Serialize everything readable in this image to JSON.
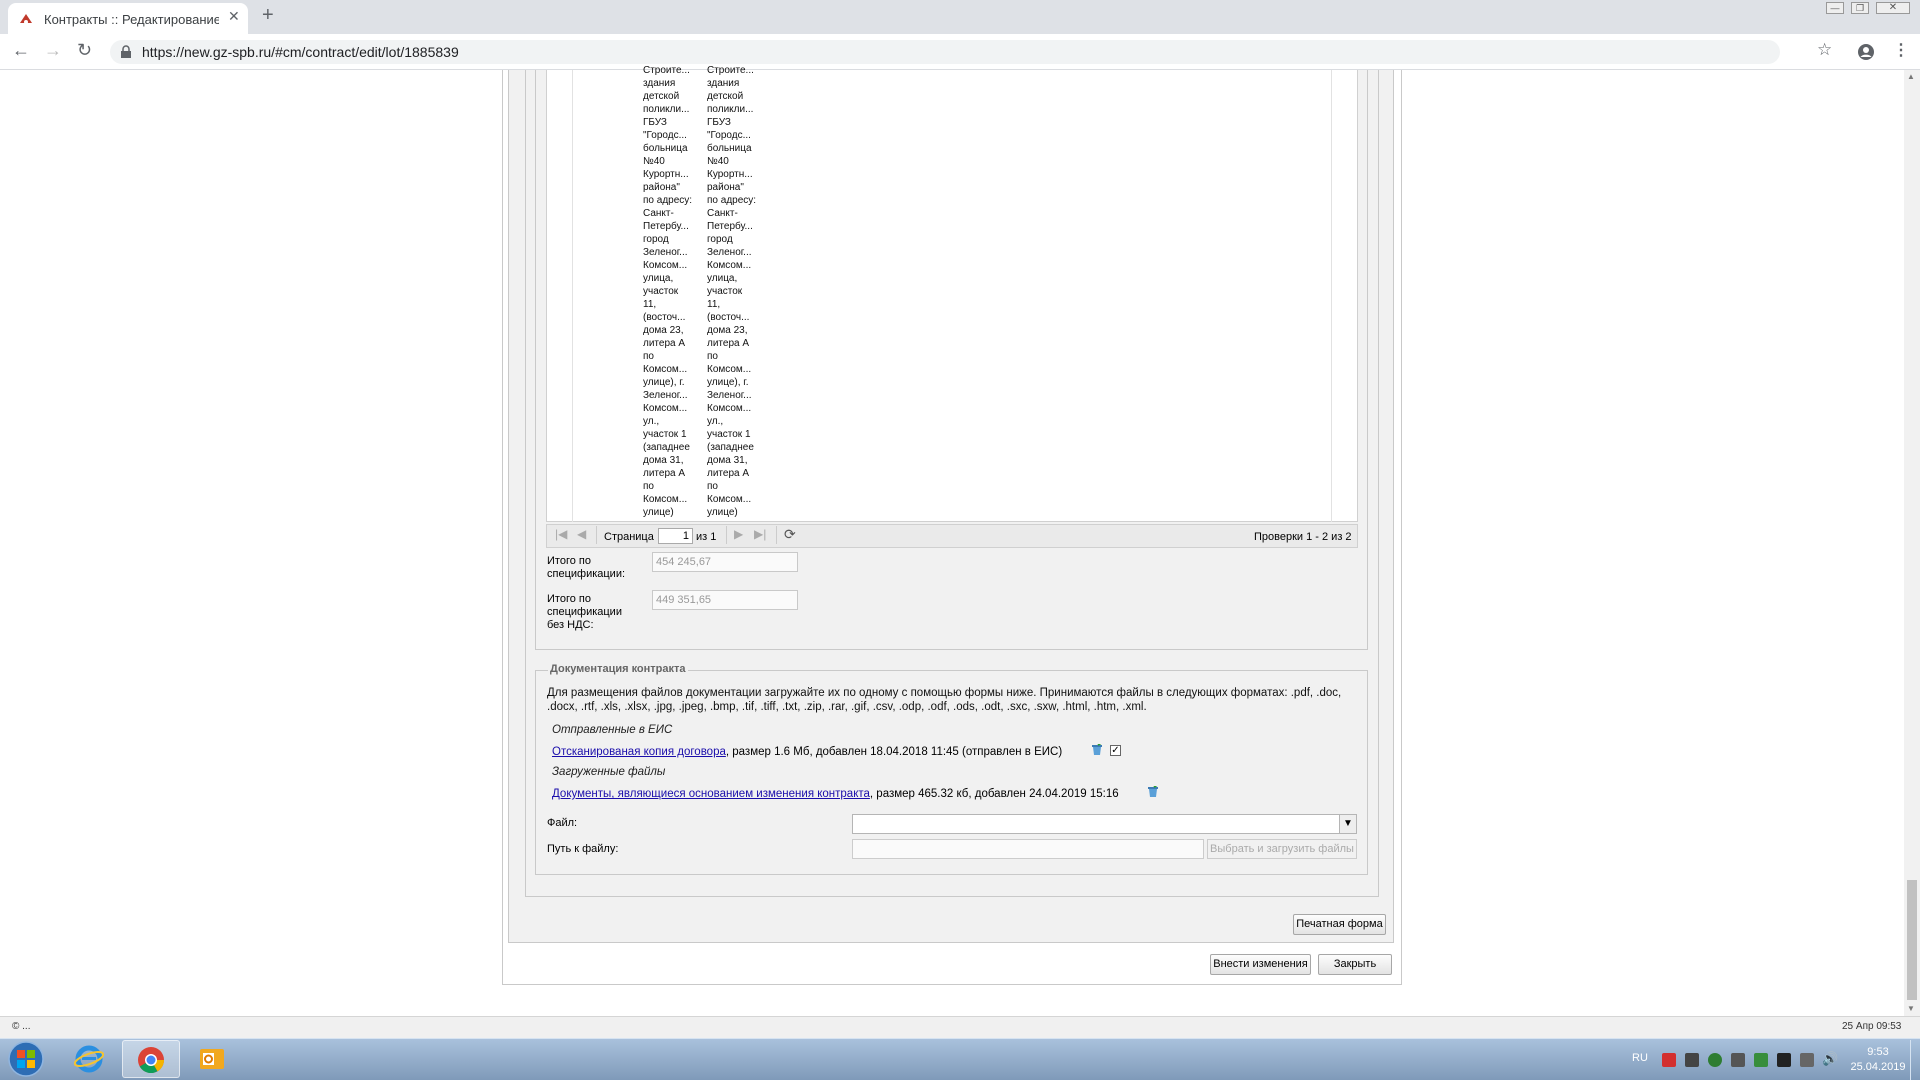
{
  "browser": {
    "tab_title": "Контракты :: Редактирование ко",
    "url": "https://new.gz-spb.ru/#cm/contract/edit/lot/1885839"
  },
  "grid": {
    "col1_lines": [
      "Строите...",
      "здания",
      "детской",
      "поликли...",
      "ГБУЗ",
      "\"Городс...",
      "больница",
      "№40",
      "Курортн...",
      "района\"",
      "по адресу:",
      "Санкт-",
      "Петербу...",
      "город",
      "Зеленог...",
      "Комсом...",
      "улица,",
      "участок",
      "11,",
      "(восточ...",
      "дома 23,",
      "литера А",
      "по",
      "Комсом...",
      "улице), г.",
      "Зеленог...",
      "Комсом...",
      "ул.,",
      "участок 1",
      "(западнее",
      "дома 31,",
      "литера А",
      "по",
      "Комсом...",
      "улице)"
    ],
    "col2_lines": [
      "Строите...",
      "здания",
      "детской",
      "поликли...",
      "ГБУЗ",
      "\"Городс...",
      "больница",
      "№40",
      "Курортн...",
      "района\"",
      "по адресу:",
      "Санкт-",
      "Петербу...",
      "город",
      "Зеленог...",
      "Комсом...",
      "улица,",
      "участок",
      "11,",
      "(восточ...",
      "дома 23,",
      "литера А",
      "по",
      "Комсом...",
      "улице), г.",
      "Зеленог...",
      "Комсом...",
      "ул.,",
      "участок 1",
      "(западнее",
      "дома 31,",
      "литера А",
      "по",
      "Комсом...",
      "улице)"
    ]
  },
  "pager": {
    "page_label": "Страница",
    "page_value": "1",
    "of_label": "из 1",
    "summary": "Проверки 1 - 2 из 2"
  },
  "totals": {
    "total_label": "Итого по спецификации:",
    "total_value": "454 245,67",
    "total_no_vat_label": "Итого по спецификации без НДС:",
    "total_no_vat_value": "449 351,65"
  },
  "docs": {
    "legend": "Документация контракта",
    "description": "Для размещения файлов документации загружайте их по одному с помощью формы ниже. Принимаются файлы в следующих форматах: .pdf, .doc, .docx, .rtf, .xls, .xlsx, .jpg, .jpeg, .bmp, .tif, .tiff, .txt, .zip, .rar, .gif, .csv, .odp, .odf, .ods, .odt, .sxc, .sxw, .html, .htm, .xml.",
    "sent_heading": "Отправленные в ЕИС",
    "sent_file_link": "Отсканированая копия договора",
    "sent_file_meta": ", размер 1.6 Мб, добавлен 18.04.2018 11:45 (отправлен в ЕИС)",
    "uploaded_heading": "Загруженные файлы",
    "uploaded_file_link": "Документы, являющиеся основанием изменения контракта",
    "uploaded_file_meta": ", размер 465.32 кб, добавлен 24.04.2019 15:16",
    "file_label": "Файл:",
    "path_label": "Путь к файлу:",
    "upload_button": "Выбрать и загрузить файлы"
  },
  "actions": {
    "print_form": "Печатная форма",
    "apply_changes": "Внести изменения",
    "close": "Закрыть"
  },
  "statusbar": {
    "left": "© ...",
    "right": "25 Апр 09:53"
  },
  "taskbar": {
    "lang": "RU",
    "time": "9:53",
    "date": "25.04.2019"
  }
}
